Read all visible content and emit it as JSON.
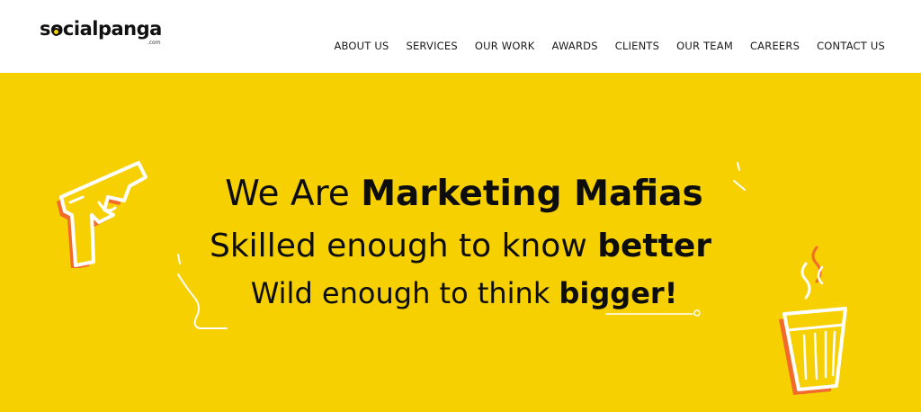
{
  "brand": {
    "name": "socialpanga",
    "suffix": ".com"
  },
  "nav": {
    "items": [
      "ABOUT US",
      "SERVICES",
      "OUR WORK",
      "AWARDS",
      "CLIENTS",
      "OUR TEAM",
      "CAREERS",
      "CONTACT US"
    ]
  },
  "hero": {
    "line1_regular": "We Are ",
    "line1_bold": "Marketing Mafias",
    "line2_regular": "Skilled enough to know ",
    "line2_bold": "better",
    "line3_regular": "Wild enough to think ",
    "line3_bold": "bigger!"
  },
  "colors": {
    "hero_background": "#f6d000",
    "accent_orange": "#f26b2a",
    "text": "#0d0d0d"
  },
  "icons": [
    "gun-illustration",
    "tea-glass-illustration"
  ]
}
